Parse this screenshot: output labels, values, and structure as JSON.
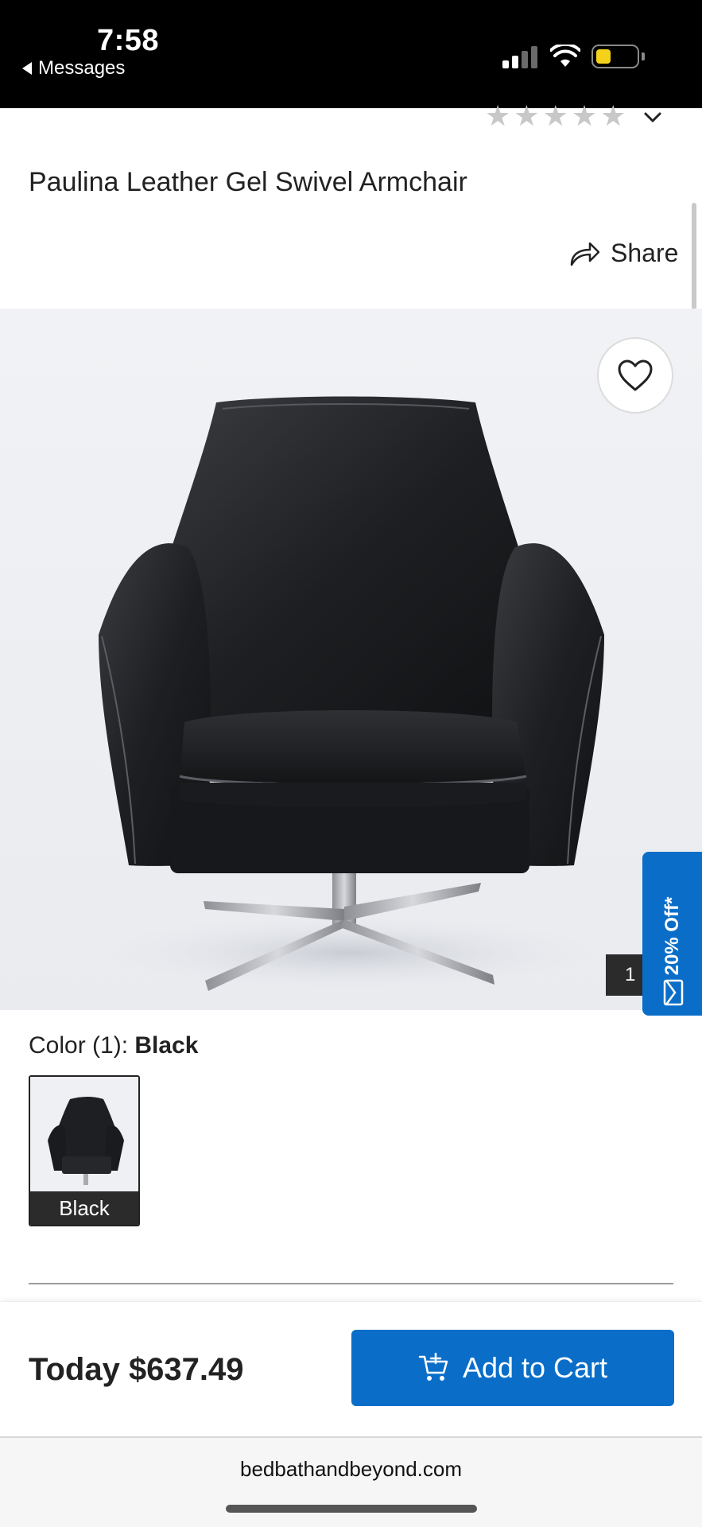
{
  "status_bar": {
    "time": "7:58",
    "back_label": "Messages",
    "battery_color": "#f5d21a"
  },
  "rating": {
    "stars_filled": 0,
    "stars_total": 5
  },
  "product": {
    "title": "Paulina Leather Gel Swivel Armchair",
    "share_label": "Share",
    "image_counter": "1",
    "promo_label": "20% Off*"
  },
  "color": {
    "label": "Color (1):",
    "selected": "Black",
    "swatches": [
      {
        "label": "Black"
      }
    ]
  },
  "purchase": {
    "price": "Today $637.49",
    "add_to_cart_label": "Add to Cart"
  },
  "browser": {
    "url": "bedbathandbeyond.com"
  },
  "colors": {
    "accent": "#0a6ec8",
    "text": "#222222"
  }
}
